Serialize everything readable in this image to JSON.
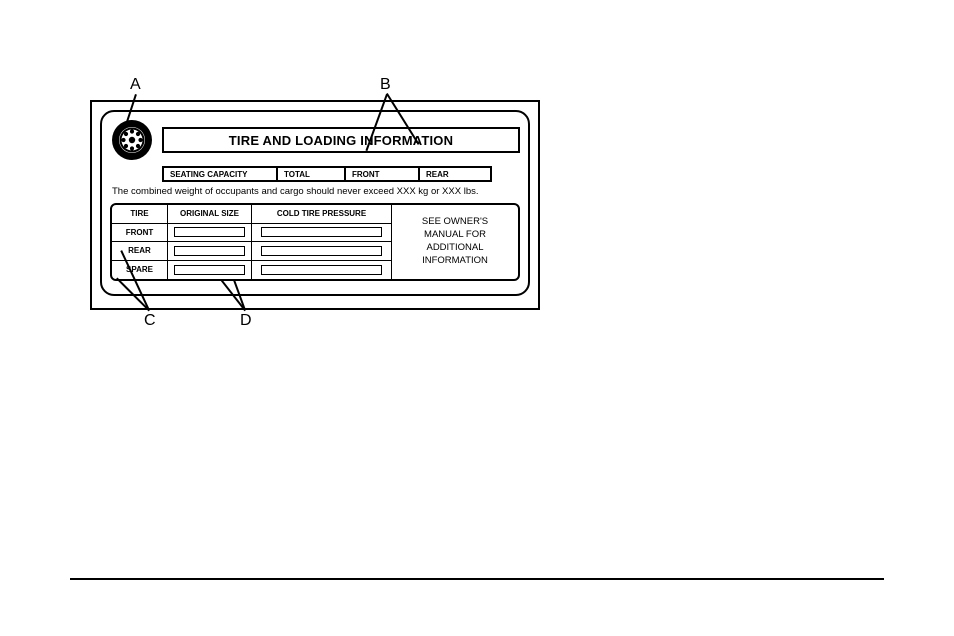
{
  "callouts": {
    "A": "A",
    "B": "B",
    "C": "C",
    "D": "D"
  },
  "placard": {
    "title": "TIRE AND LOADING INFORMATION",
    "seating": {
      "capacity_label": "SEATING CAPACITY",
      "total_label": "TOTAL",
      "front_label": "FRONT",
      "rear_label": "REAR"
    },
    "weight_line": "The combined weight of occupants and cargo should never exceed  XXX kg or XXX lbs.",
    "grid": {
      "headers": {
        "tire": "TIRE",
        "size": "ORIGINAL SIZE",
        "pressure": "COLD TIRE PRESSURE"
      },
      "rows": {
        "front": "FRONT",
        "rear": "REAR",
        "spare": "SPARE"
      }
    },
    "side_note_l1": "SEE OWNER'S",
    "side_note_l2": "MANUAL FOR",
    "side_note_l3": "ADDITIONAL",
    "side_note_l4": "INFORMATION"
  }
}
